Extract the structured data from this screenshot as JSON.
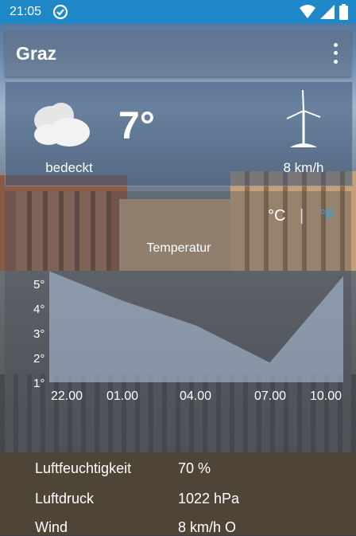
{
  "status": {
    "time": "21:05"
  },
  "app": {
    "title": "Graz"
  },
  "current": {
    "temperature": "7°",
    "condition": "bedeckt",
    "wind": "8 km/h",
    "condition_icon": "cloud-icon",
    "wind_icon": "windmill-icon"
  },
  "units": {
    "celsius": "°C",
    "separator": "|",
    "fahrenheit": "°F",
    "selected": "°C",
    "accent": "#2aa5e8"
  },
  "chart_data": {
    "type": "area",
    "title": "Temperatur",
    "x": [
      "22.00",
      "01.00",
      "04.00",
      "07.00",
      "10.00"
    ],
    "y_ticks": [
      "1°",
      "2°",
      "3°",
      "4°",
      "5°"
    ],
    "ylim": [
      1,
      5
    ],
    "values": [
      5.5,
      4.3,
      3.3,
      1.8,
      5.3
    ]
  },
  "details": [
    {
      "label": "Luftfeuchtigkeit",
      "value": "70 %"
    },
    {
      "label": "Luftdruck",
      "value": "1022 hPa"
    },
    {
      "label": "Wind",
      "value": "8 km/h O"
    }
  ],
  "colors": {
    "status_bar": "#1e88c8",
    "bottom_panel": "#4e4536"
  }
}
